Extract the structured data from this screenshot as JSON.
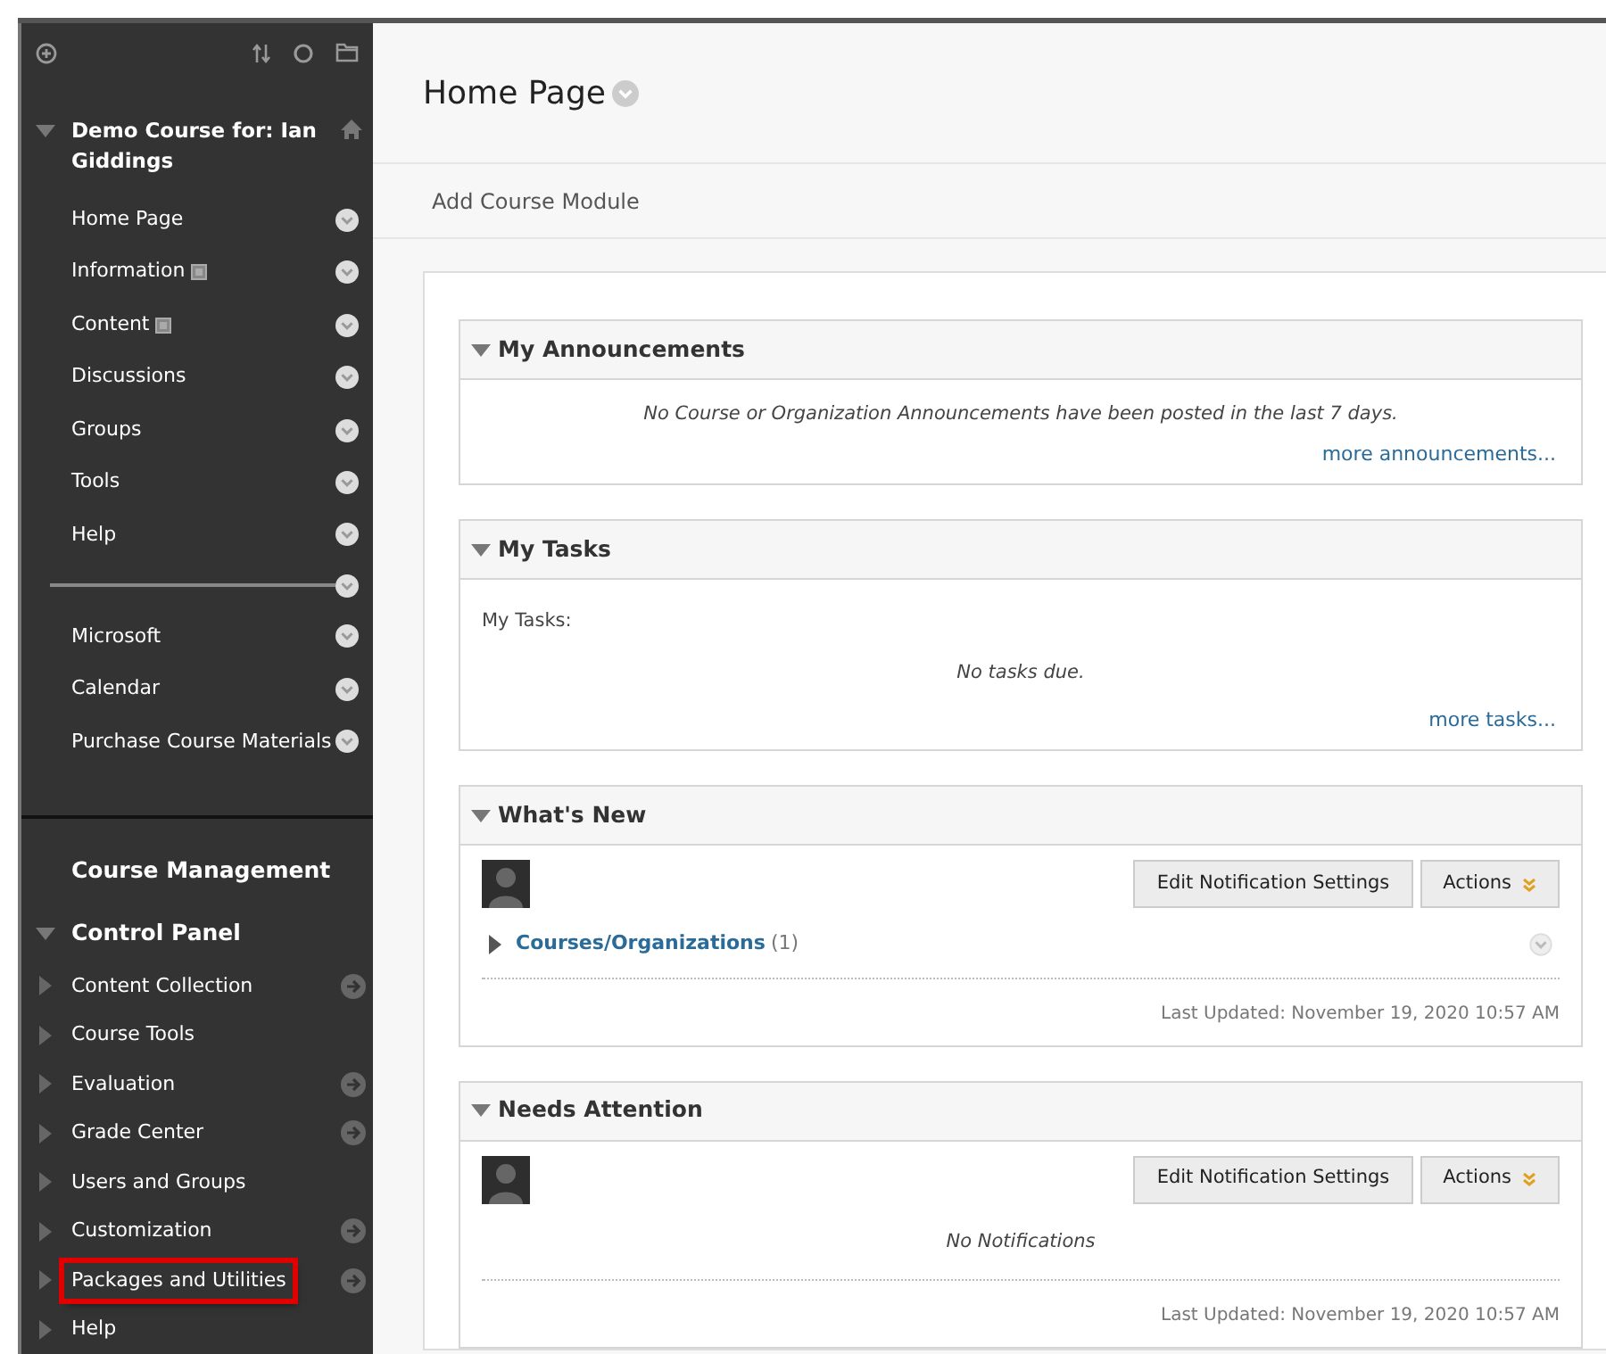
{
  "course_menu": {
    "title": "Demo Course for: Ian Giddings",
    "expanded": true,
    "items": [
      {
        "kind": "link",
        "label": "Home Page",
        "content_area": false
      },
      {
        "kind": "link",
        "label": "Information",
        "content_area": true
      },
      {
        "kind": "link",
        "label": "Content",
        "content_area": true
      },
      {
        "kind": "link",
        "label": "Discussions",
        "content_area": false
      },
      {
        "kind": "link",
        "label": "Groups",
        "content_area": false
      },
      {
        "kind": "link",
        "label": "Tools",
        "content_area": false
      },
      {
        "kind": "link",
        "label": "Help",
        "content_area": false
      },
      {
        "kind": "divider"
      },
      {
        "kind": "link",
        "label": "Microsoft",
        "content_area": false
      },
      {
        "kind": "link",
        "label": "Calendar",
        "content_area": false
      },
      {
        "kind": "link",
        "label": "Purchase Course Materials",
        "content_area": false
      }
    ]
  },
  "course_management": {
    "title": "Course Management",
    "panel_title": "Control Panel",
    "expanded": true,
    "items": [
      {
        "label": "Content Collection",
        "has_link": true,
        "highlighted": false
      },
      {
        "label": "Course Tools",
        "has_link": false,
        "highlighted": false
      },
      {
        "label": "Evaluation",
        "has_link": true,
        "highlighted": false
      },
      {
        "label": "Grade Center",
        "has_link": true,
        "highlighted": false
      },
      {
        "label": "Users and Groups",
        "has_link": false,
        "highlighted": false
      },
      {
        "label": "Customization",
        "has_link": true,
        "highlighted": false
      },
      {
        "label": "Packages and Utilities",
        "has_link": true,
        "highlighted": true
      },
      {
        "label": "Help",
        "has_link": false,
        "highlighted": false
      }
    ]
  },
  "page": {
    "title": "Home Page",
    "action": "Add Course Module"
  },
  "modules": [
    {
      "kind": "announcements",
      "title": "My Announcements",
      "message": "No Course or Organization Announcements have been posted in the last 7 days.",
      "more_link": "more announcements..."
    },
    {
      "kind": "tasks",
      "title": "My Tasks",
      "label": "My Tasks:",
      "message": "No tasks due.",
      "more_link": "more tasks..."
    },
    {
      "kind": "notifications",
      "title": "What's New",
      "buttons": [
        "Edit Notification Settings",
        "Actions"
      ],
      "group": {
        "label": "Courses/Organizations",
        "count": "(1)",
        "expanded": false
      },
      "updated": "Last Updated: November 19, 2020 10:57 AM"
    },
    {
      "kind": "notifications",
      "title": "Needs Attention",
      "buttons": [
        "Edit Notification Settings",
        "Actions"
      ],
      "message": "No Notifications",
      "updated": "Last Updated: November 19, 2020 10:57 AM"
    }
  ]
}
